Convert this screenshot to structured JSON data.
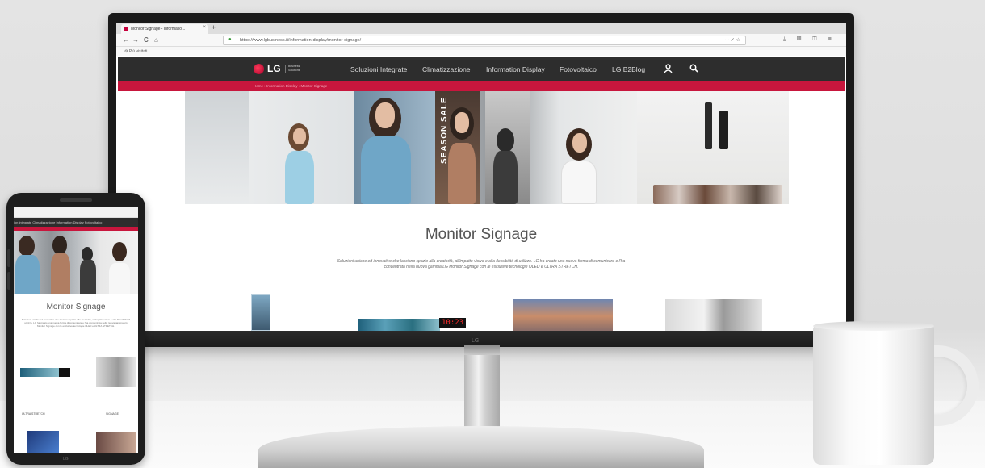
{
  "browser": {
    "tab_title": "Monitor Signage - Informatio...",
    "tab_close": "×",
    "new_tab": "+",
    "back": "←",
    "forward": "→",
    "reload": "C",
    "home": "⌂",
    "url": "https://www.lgbusiness.it/information-display/monitor-signage/",
    "url_icons": "··· ✓ ☆",
    "toolbar_icons": "⤓ ▥ ◫ ≡",
    "bookmark": "⚙ Più visitati"
  },
  "site": {
    "logo_text": "LG",
    "logo_sub": "Business Solutions",
    "menu": [
      "Soluzioni Integrate",
      "Climatizzazione",
      "Information Display",
      "Fotovoltaico",
      "LG B2Blog"
    ],
    "breadcrumb": "Home  ›  Information Display  ›  Monitor Signage",
    "hero_sale_text": "SEASON SALE",
    "page_title": "Monitor Signage",
    "description": "Soluzioni uniche ed innovative che lasciano spazio alla creatività, all'impatto visivo e alla flessibilità di utilizzo. LG ha creato una nuova forma di comunicare e l'ha concentrata nella nuova gamma LG Monitor Signage con le esclusive tecnologie OLED e ULTRA STRETCH.",
    "clock_value": "10:23"
  },
  "monitor": {
    "bezel_logo": "LG"
  },
  "phone": {
    "nav": "ion Integrate   Climatizzazione   Information Display   Fotovoltaico",
    "page_title": "Monitor Signage",
    "description": "Soluzioni uniche ed innovative che lasciano spazio alla creatività, all'impatto visivo e alla flessibilità di utilizzo. LG ha creato una nuova forma di comunicare e l'ha concentrata nella nuova gamma LG Monitor Signage con le esclusive tecnologie OLED e ULTRA STRETCH.",
    "label_left": "ULTRA STRETCH",
    "label_right": "SIGNAGE",
    "home_mark": "LG"
  },
  "colors": {
    "lg_red": "#c8163d",
    "nav_dark": "#2d2d2d"
  }
}
